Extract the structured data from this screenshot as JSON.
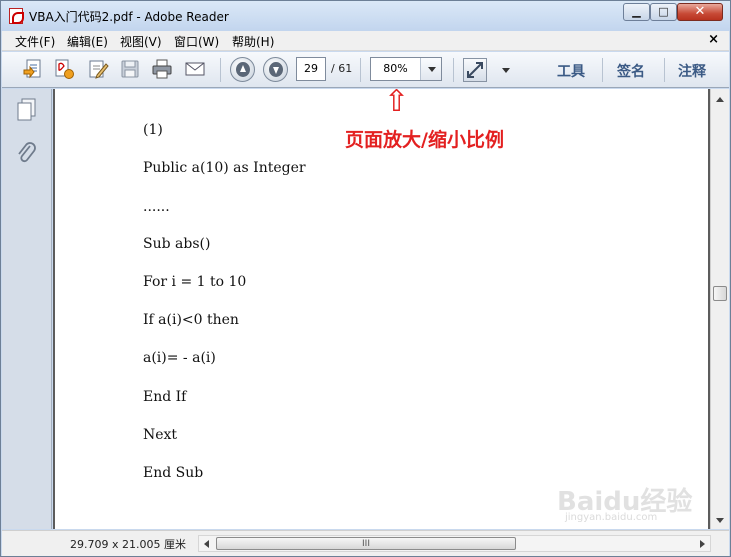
{
  "window": {
    "title": "VBA入门代码2.pdf - Adobe Reader",
    "minimize_glyph": "▁",
    "maximize_glyph": "□",
    "close_glyph": "✕"
  },
  "menu": {
    "items": [
      "文件(F)",
      "编辑(E)",
      "视图(V)",
      "窗口(W)",
      "帮助(H)"
    ],
    "close_glyph": "×"
  },
  "toolbar": {
    "current_page": "29",
    "total_pages": "/ 61",
    "zoom": "80%",
    "links": [
      "工具",
      "签名",
      "注释"
    ]
  },
  "document": {
    "lines": [
      "(1)",
      "Public a(10) as Integer",
      "......",
      "Sub abs()",
      "For i = 1 to 10",
      "If a(i)<0 then",
      "a(i)= - a(i)",
      "End If",
      "Next",
      "End Sub"
    ],
    "annotation_arrow": "⇧",
    "annotation_text": "页面放大/缩小比例"
  },
  "statusbar": {
    "page_size": "29.709 x 21.005 厘米",
    "grip": "III"
  },
  "watermark": {
    "text": "Baidu经验",
    "sub": "jingyan.baidu.com"
  },
  "colors": {
    "annotation": "#e32020",
    "link": "#3b5a85",
    "doc_background": "#5c5c5c"
  }
}
